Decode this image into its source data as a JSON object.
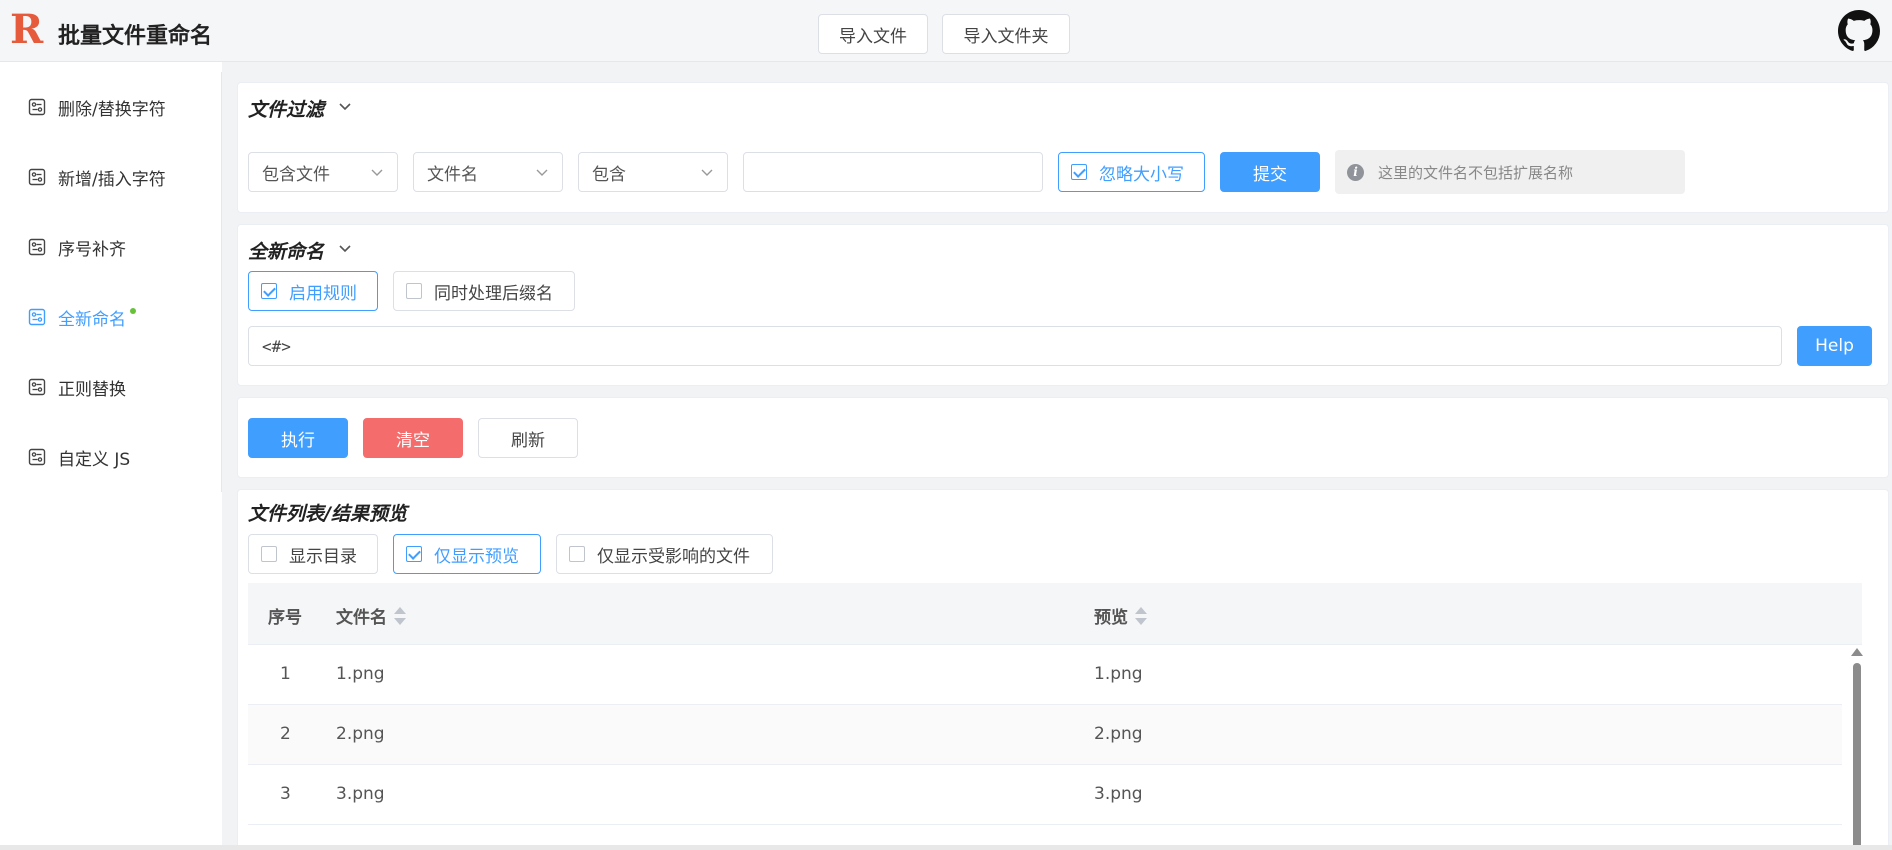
{
  "header": {
    "logo_letter": "R",
    "title": "批量文件重命名",
    "import_file": "导入文件",
    "import_folder": "导入文件夹",
    "github_icon": "github-icon"
  },
  "sidebar": {
    "items": [
      {
        "label": "删除/替换字符",
        "icon": "rule-icon",
        "active": false
      },
      {
        "label": "新增/插入字符",
        "icon": "rule-icon",
        "active": false
      },
      {
        "label": "序号补齐",
        "icon": "rule-icon",
        "active": false
      },
      {
        "label": "全新命名",
        "icon": "rule-icon",
        "active": true
      },
      {
        "label": "正则替换",
        "icon": "rule-icon",
        "active": false
      },
      {
        "label": "自定义 JS",
        "icon": "rule-icon",
        "active": false
      }
    ]
  },
  "filter": {
    "title": "文件过滤",
    "select_scope": "包含文件",
    "select_field": "文件名",
    "select_op": "包含",
    "input_value": "",
    "ignore_case": "忽略大小写",
    "submit": "提交",
    "tip": "这里的文件名不包括扩展名称"
  },
  "rename": {
    "title": "全新命名",
    "enable_rule": "启用规则",
    "with_ext": "同时处理后缀名",
    "pattern": "<#>",
    "help": "Help"
  },
  "actions": {
    "execute": "执行",
    "clear": "清空",
    "refresh": "刷新"
  },
  "files": {
    "title": "文件列表/结果预览",
    "show_dirs": "显示目录",
    "only_preview": "仅显示预览",
    "only_affected": "仅显示受影响的文件",
    "columns": [
      "序号",
      "文件名",
      "预览"
    ],
    "rows": [
      {
        "index": "1",
        "name": "1.png",
        "preview": "1.png"
      },
      {
        "index": "2",
        "name": "2.png",
        "preview": "2.png"
      },
      {
        "index": "3",
        "name": "3.png",
        "preview": "3.png"
      }
    ]
  },
  "colors": {
    "primary": "#409eff",
    "danger": "#f56c6c",
    "success_dot": "#67c23a",
    "logo": "#e55b3c"
  }
}
